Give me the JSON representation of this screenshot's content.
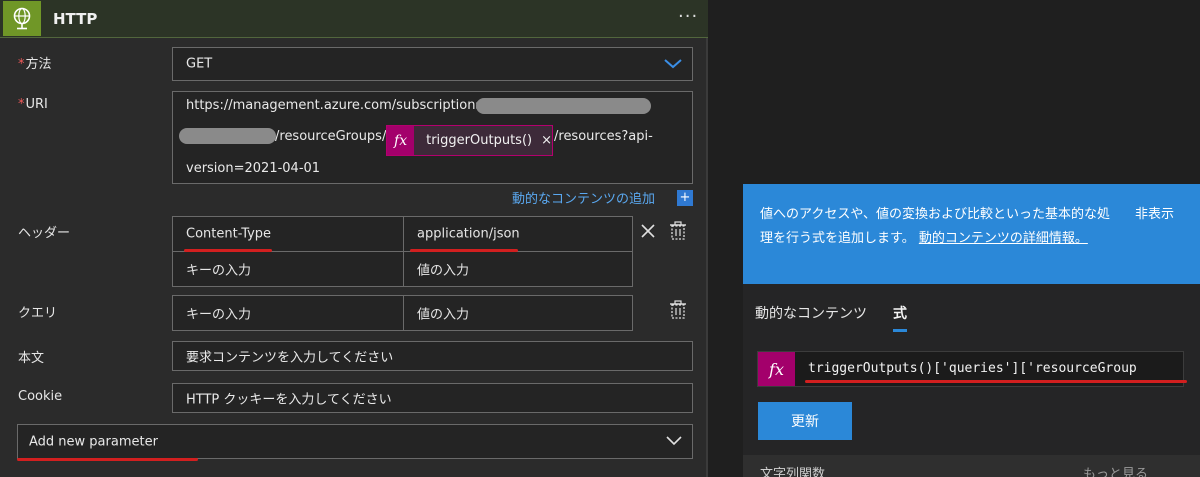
{
  "card": {
    "title": "HTTP",
    "more": "···",
    "method_label": "方法",
    "method_value": "GET",
    "uri_label": "URI",
    "uri_line1": "https://management.azure.com/subscriptions/",
    "uri_line2_mid": "/resourceGroups/",
    "uri_line2_end": "/resources?api-",
    "uri_line3": "version=2021-04-01",
    "uri_token_label": "triggerOutputs()",
    "uri_token_close": "×",
    "dynamic_content_add": "動的なコンテンツの追加",
    "dynamic_content_add_icon": "+",
    "headers_label": "ヘッダー",
    "headers": [
      {
        "key": "Content-Type",
        "value": "application/json"
      },
      {
        "key": "キーの入力",
        "value": "値の入力"
      }
    ],
    "query_label": "クエリ",
    "query": [
      {
        "key": "キーの入力",
        "value": "値の入力"
      }
    ],
    "body_label": "本文",
    "body_placeholder": "要求コンテンツを入力してください",
    "cookie_label": "Cookie",
    "cookie_placeholder": "HTTP クッキーを入力してください",
    "add_param_label": "Add new parameter",
    "required_mark": "*"
  },
  "flyout": {
    "info_text": "値へのアクセスや、値の変換および比較といった基本的な処理を行う式を追加します。",
    "info_link": "動的コンテンツの詳細情報。",
    "hide": "非表示",
    "tabs": [
      {
        "label": "動的なコンテンツ"
      },
      {
        "label": "式"
      }
    ],
    "active_tab": "式",
    "expression": "triggerOutputs()['queries']['resourceGroup",
    "update_label": "更新",
    "cut_label": "文字列関数",
    "cut_more": "もっと見る"
  },
  "icons": {
    "http": "globe-icon",
    "method_dropdown": "chevron-down-icon",
    "add_param_dropdown": "chevron-down-icon",
    "header_remove": "close-icon",
    "header_delete": "trash-icon",
    "query_delete": "trash-icon",
    "fx": "fx-icon"
  },
  "colors": {
    "accent_blue": "#2b88d8",
    "http_green": "#709727",
    "fx_magenta": "#a3006b",
    "annotation_red": "#d21f1f"
  }
}
